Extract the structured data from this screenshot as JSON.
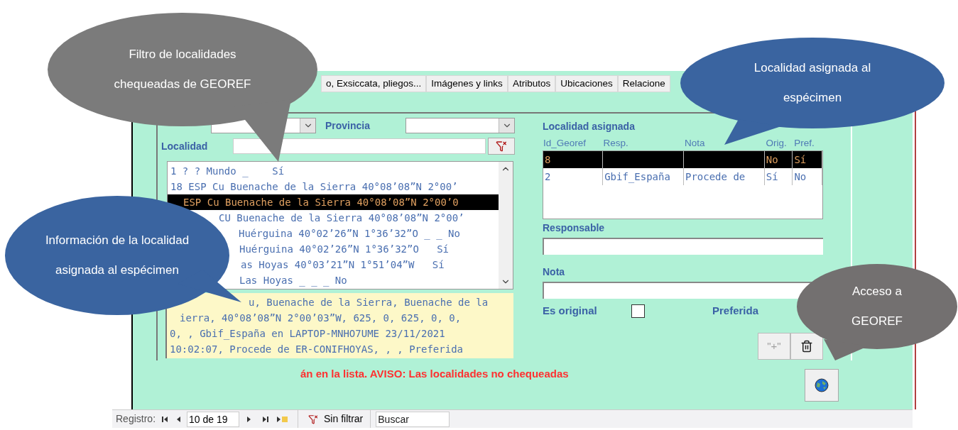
{
  "tabs": [
    {
      "label": "o, Exsiccata, pliegos...",
      "selected": false
    },
    {
      "label": "Imágenes y links",
      "selected": false
    },
    {
      "label": "Atributos",
      "selected": false
    },
    {
      "label": "Ubicaciones",
      "selected": false
    },
    {
      "label": "Relacione",
      "selected": false
    }
  ],
  "filter": {
    "province_label": "Provincia",
    "locality_label": "Localidad"
  },
  "locality_list": [
    {
      "text": "1 ? ? Mundo _    Sí",
      "selected": false
    },
    {
      "text": "18 ESP Cu Buenache de la Sierra 40°08’08”N 2°00’",
      "selected": false
    },
    {
      "text": "ESP Cu Buenache de la Sierra 40°08’08”N 2°00’0",
      "selected": true
    },
    {
      "text": "CU Buenache de la Sierra 40°08’08”N 2°00’",
      "selected": false
    },
    {
      "text": "Huérguina 40°02’26”N 1°36’32”O _ _ No",
      "selected": false
    },
    {
      "text": "Huérguina 40°02’26”N 1°36’32”O   Sí",
      "selected": false
    },
    {
      "text": "as Hoyas 40°03’21”N 1°51’04”W   Sí",
      "selected": false
    },
    {
      "text": "Las Hoyas _ _ _ No",
      "selected": false
    }
  ],
  "info_lines": [
    "u, Buenache de la Sierra, Buenache de la",
    "ierra, 40°08’08”N 2°00’03”W, 625, 0, 625, 0, 0,",
    "0, , Gbif_España en LAPTOP-MNHO7UME 23/11/2021",
    "10:02:07, Procede de ER-CONIFHOYAS, , , Preferida"
  ],
  "assigned": {
    "title": "Localidad asignada",
    "columns": [
      "Id_Georef",
      "Resp.",
      "Nota",
      "Orig.",
      "Pref."
    ],
    "rows": [
      {
        "cells": [
          "8",
          "",
          "",
          "No",
          "Sí"
        ],
        "selected": true
      },
      {
        "cells": [
          "2",
          "Gbif_España",
          "Procede de",
          "Sí",
          "No"
        ],
        "selected": false
      }
    ],
    "responsable_label": "Responsable",
    "nota_label": "Nota",
    "original_label": "Es original",
    "original_checked": false,
    "preferida_label": "Preferida",
    "add_button": {
      "label": "\"+\"",
      "disabled": true
    }
  },
  "warning": "án en la lista. AVISO: Las localidades no chequeadas",
  "navigation": {
    "label": "Registro:",
    "record": "10 de 19",
    "filter": "Sin filtrar",
    "search_placeholder": "Buscar"
  },
  "callouts": [
    {
      "text": "Filtro de localidades chequeadas de GEOREF",
      "color": "#7b7b7b"
    },
    {
      "text": "Información de la localidad asignada al espécimen",
      "color": "#3a64a0"
    },
    {
      "text": "Localidad asignada al espécimen",
      "color": "#3a64a0"
    },
    {
      "text": "Acceso a GEOREF",
      "color": "#737070"
    }
  ]
}
